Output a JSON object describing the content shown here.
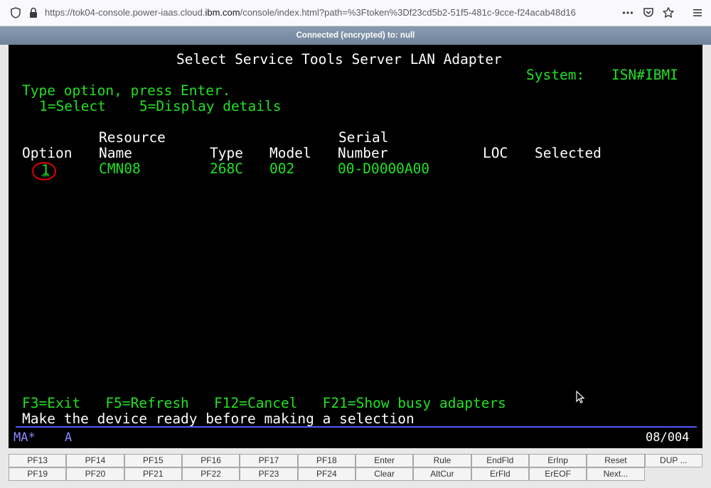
{
  "browser": {
    "url_prefix": "https://tok04-console.power-iaas.cloud.",
    "url_domain": "ibm.com",
    "url_suffix": "/console/index.html?path=%3Ftoken%3Df23cd5b2-51f5-481c-9cce-f24acab48d16",
    "menu_icon": "more-horizontal-icon",
    "pocket_icon": "pocket-icon",
    "bookmark_icon": "star-icon",
    "hamburger_icon": "hamburger-menu-icon"
  },
  "banner": {
    "text": "Connected (encrypted) to: null"
  },
  "screen": {
    "title": "Select Service Tools Server LAN Adapter",
    "system_label": "System:",
    "system_value": "ISN#IBMI",
    "instruction": "Type option, press Enter.",
    "options": "1=Select    5=Display details",
    "columns": {
      "resource_top": "Resource",
      "serial_top": "Serial",
      "option": "Option",
      "name": "Name",
      "type": "Type",
      "model": "Model",
      "number": "Number",
      "loc": "LOC",
      "selected": "Selected"
    },
    "rows": [
      {
        "option": "1",
        "name": "CMN08",
        "type": "268C",
        "model": "002",
        "serial": "00-D0000A00"
      }
    ],
    "fkeys": "F3=Exit   F5=Refresh   F12=Cancel   F21=Show busy adapters",
    "message": "Make the device ready before making a selection",
    "status_left": "MA*",
    "status_mode": "A",
    "status_cursor": "08/004"
  },
  "pf_keys": {
    "row1": [
      "PF13",
      "PF14",
      "PF15",
      "PF16",
      "PF17",
      "PF18",
      "Enter",
      "Rule",
      "EndFld",
      "ErInp",
      "Reset",
      "DUP ..."
    ],
    "row2": [
      "PF19",
      "PF20",
      "PF21",
      "PF22",
      "PF23",
      "PF24",
      "Clear",
      "AltCur",
      "ErFld",
      "ErEOF",
      "Next...",
      ""
    ]
  },
  "colors": {
    "terminal_bg": "#000000",
    "text_green": "#22e022",
    "text_white": "#ffffff",
    "status_blue": "#8a8aff",
    "highlight_red": "#e00000"
  }
}
